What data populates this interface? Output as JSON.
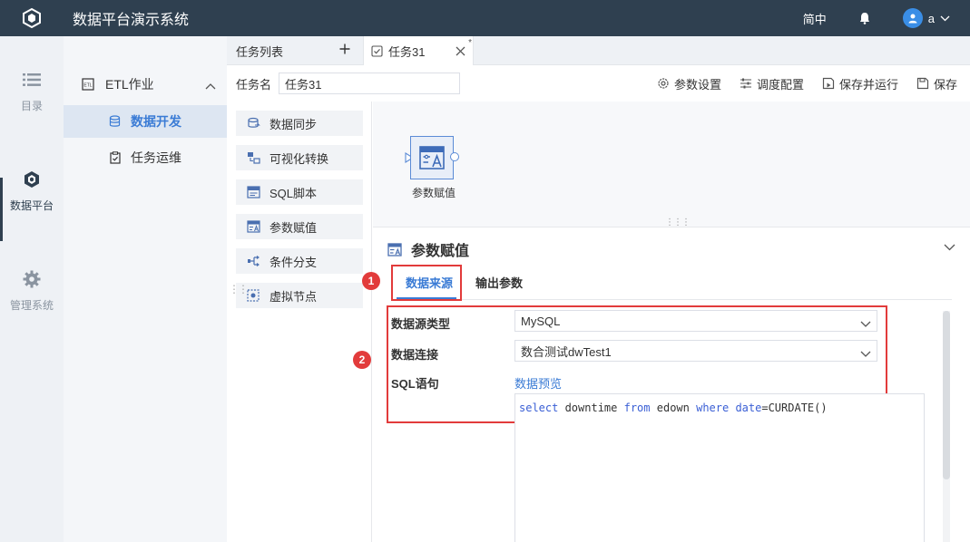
{
  "app": {
    "title": "数据平台演示系统"
  },
  "topbar": {
    "lang": "简中",
    "user": "a"
  },
  "leftnav": {
    "items": [
      {
        "label": "目录",
        "icon": "list-icon"
      },
      {
        "label": "数据平台",
        "icon": "platform-cube-icon",
        "active": true
      },
      {
        "label": "管理系统",
        "icon": "gear-icon"
      }
    ]
  },
  "subnav": {
    "group": "ETL作业",
    "items": [
      {
        "label": "数据开发",
        "active": true
      },
      {
        "label": "任务运维"
      }
    ]
  },
  "tabs": {
    "list_label": "任务列表",
    "task_tab": "任务31",
    "unsaved_mark": "*"
  },
  "toolbar": {
    "task_name_label": "任务名",
    "task_name_value": "任务31",
    "param_settings": "参数设置",
    "schedule_config": "调度配置",
    "save_and_run": "保存并运行",
    "save": "保存"
  },
  "palette": {
    "items": [
      {
        "label": "数据同步",
        "icon": "data-sync-icon"
      },
      {
        "label": "可视化转换",
        "icon": "visual-transform-icon"
      },
      {
        "label": "SQL脚本",
        "icon": "sql-script-icon"
      },
      {
        "label": "参数赋值",
        "icon": "param-assign-icon"
      },
      {
        "label": "条件分支",
        "icon": "condition-branch-icon"
      },
      {
        "label": "虚拟节点",
        "icon": "virtual-node-icon"
      }
    ]
  },
  "canvas": {
    "node_label": "参数赋值"
  },
  "panel": {
    "title": "参数赋值",
    "tabs": [
      {
        "label": "数据来源",
        "active": true
      },
      {
        "label": "输出参数"
      }
    ],
    "badges": [
      "1",
      "2"
    ],
    "form": {
      "source_type_label": "数据源类型",
      "source_type_value": "MySQL",
      "connection_label": "数据连接",
      "connection_value": "数合测试dwTest1",
      "sql_label": "SQL语句",
      "preview_link": "数据预览",
      "sql_parts": [
        "select",
        " downtime ",
        "from",
        " edown ",
        "where",
        " ",
        "date",
        "=CURDATE()"
      ]
    }
  },
  "colors": {
    "topbar": "#2f4050",
    "accent": "#3a7bd5",
    "highlight": "#e23b3b"
  }
}
